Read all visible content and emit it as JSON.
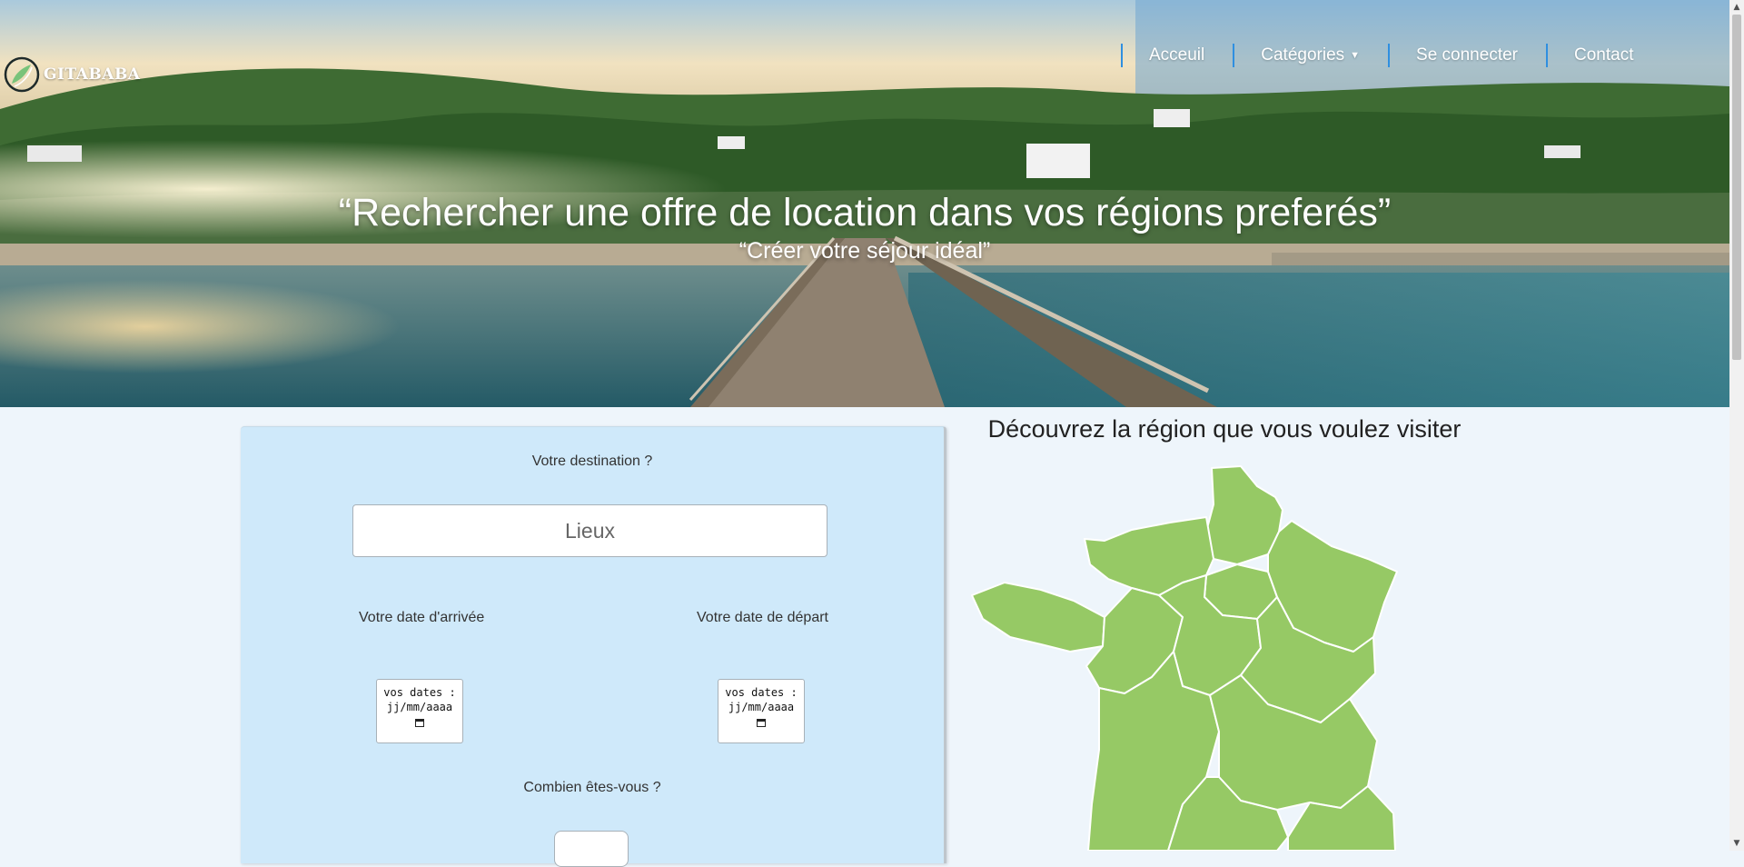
{
  "brand": {
    "name": "GITABABA"
  },
  "nav": {
    "items": [
      {
        "label": "Acceuil"
      },
      {
        "label": "Catégories",
        "caret": "▼"
      },
      {
        "label": "Se connecter"
      },
      {
        "label": "Contact"
      }
    ]
  },
  "hero": {
    "title": "“Rechercher une offre de location dans vos régions preferés”",
    "subtitle": "“Créer votre séjour idéal”"
  },
  "search": {
    "destination_label": "Votre destination ?",
    "destination_placeholder": "Lieux",
    "arrival_label": "Votre date d'arrivée",
    "departure_label": "Votre date de départ",
    "date_prefix": "vos dates :",
    "date_format": "jj/mm/aaaa",
    "people_label": "Combien êtes-vous ?"
  },
  "map": {
    "title": "Découvrez la région que vous voulez visiter",
    "region_color": "#96c965"
  },
  "colors": {
    "nav_separator": "#2f8fe0",
    "panel_background": "#cfe9fa",
    "page_background": "#eef5fb"
  },
  "icons": [
    "logo-globe-icon",
    "calendar-icon",
    "caret-down-icon",
    "scroll-up-icon",
    "scroll-down-icon"
  ]
}
